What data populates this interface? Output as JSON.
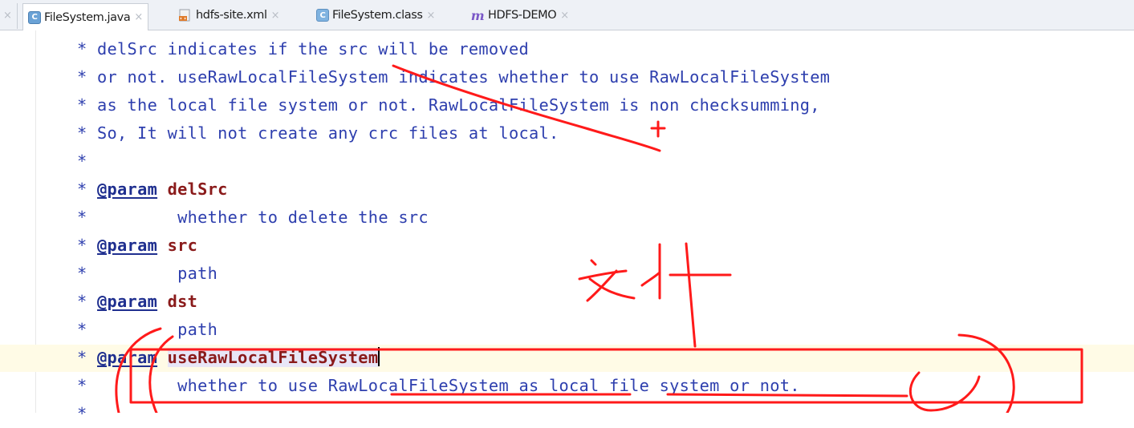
{
  "tabs": [
    {
      "label": "FileSystem.java",
      "icon": "java-class-icon",
      "active": true
    },
    {
      "label": "hdfs-site.xml",
      "icon": "xml-file-icon",
      "active": false
    },
    {
      "label": "FileSystem.class",
      "icon": "class-file-icon",
      "active": false
    },
    {
      "label": "HDFS-DEMO",
      "icon": "maven-icon",
      "active": false
    }
  ],
  "tab_close_glyph": "×",
  "editor": {
    "lines": [
      "* delSrc indicates if the src will be removed",
      "* or not. useRawLocalFileSystem indicates whether to use RawLocalFileSystem",
      "* as the local file system or not. RawLocalFileSystem is non checksumming,",
      "* So, It will not create any crc files at local.",
      "*"
    ],
    "params": [
      {
        "star": "*",
        "tag": "@param",
        "name": "delSrc"
      },
      {
        "star": "*",
        "text": "whether to delete the src"
      },
      {
        "star": "*",
        "tag": "@param",
        "name": "src"
      },
      {
        "star": "*",
        "text": "path"
      },
      {
        "star": "*",
        "tag": "@param",
        "name": "dst"
      },
      {
        "star": "*",
        "text": "path"
      },
      {
        "star": "*",
        "tag": "@param",
        "name": "useRawLocalFileSystem"
      },
      {
        "star": "*",
        "text": "whether to use RawLocalFileSystem as local file system or not."
      },
      {
        "star": "*"
      }
    ]
  },
  "annotation_color": "#ff1a1a"
}
